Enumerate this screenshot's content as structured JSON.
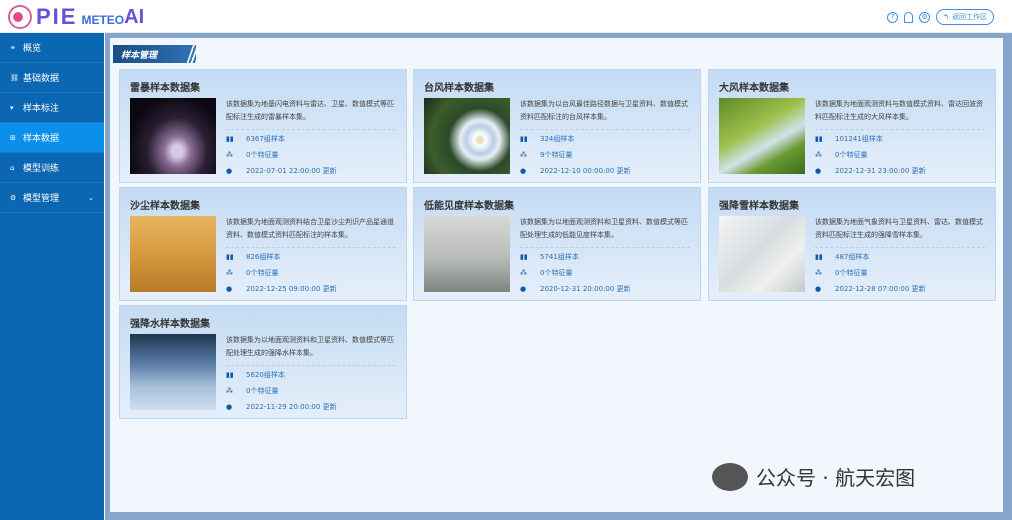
{
  "header": {
    "logo_text": "PIE METEO AI",
    "back_label": "返回工作区",
    "icons": [
      "help-icon",
      "bell-icon",
      "settings-icon"
    ]
  },
  "sidebar": {
    "items": [
      {
        "label": "概览",
        "icon": "overview-icon"
      },
      {
        "label": "基础数据",
        "icon": "data-icon"
      },
      {
        "label": "样本标注",
        "icon": "label-icon"
      },
      {
        "label": "样本数据",
        "icon": "database-icon",
        "active": true
      },
      {
        "label": "模型训练",
        "icon": "train-icon"
      },
      {
        "label": "模型管理",
        "icon": "model-icon",
        "expandable": true
      }
    ]
  },
  "main": {
    "title": "样本管理",
    "cards": [
      {
        "title": "雷暴样本数据集",
        "desc": "该数据集为地基闪电资料与雷达、卫星、数值模式等匹配标注生成的雷暴样本集。",
        "samples": "6367组样本",
        "features": "0个特征量",
        "updated": "2022-07-01 22:00:00 更新",
        "img": "thunderstorm"
      },
      {
        "title": "台风样本数据集",
        "desc": "该数据集为以台风最佳路径数据与卫星资料、数值模式资料匹配标注的台风样本集。",
        "samples": "324组样本",
        "features": "9个特征量",
        "updated": "2022-12-10 00:00:00 更新",
        "img": "typhoon"
      },
      {
        "title": "大风样本数据集",
        "desc": "该数据集为地面观测资料与数值模式资料、雷达回波资料匹配标注生成的大风样本集。",
        "samples": "101241组样本",
        "features": "0个特征量",
        "updated": "2022-12-31 23:00:00 更新",
        "img": "wind"
      },
      {
        "title": "沙尘样本数据集",
        "desc": "该数据集为地面观测资料结合卫星沙尘判识产品星通道资料、数值模式资料匹配标注的样本集。",
        "samples": "826组样本",
        "features": "0个特征量",
        "updated": "2022-12-25 09:00:00 更新",
        "img": "dust"
      },
      {
        "title": "低能见度样本数据集",
        "desc": "该数据集为以地面观测资料和卫星资料、数值模式等匹配处理生成的低能见度样本集。",
        "samples": "5741组样本",
        "features": "0个特征量",
        "updated": "2020-12-31 20:00:00 更新",
        "img": "fog"
      },
      {
        "title": "强降雪样本数据集",
        "desc": "该数据集为地面气象资料与卫星资料、雷达、数值模式资料匹配标注生成的强降雪样本集。",
        "samples": "487组样本",
        "features": "0个特征量",
        "updated": "2022-12-28 07:00:00 更新",
        "img": "snow"
      },
      {
        "title": "强降水样本数据集",
        "desc": "该数据集为以地面观测资料和卫星资料、数值模式等匹配处理生成的强降水样本集。",
        "samples": "5620组样本",
        "features": "0个特征量",
        "updated": "2022-11-29 20:00:00 更新",
        "img": "rain"
      }
    ]
  },
  "watermark": "公众号 · 航天宏图"
}
